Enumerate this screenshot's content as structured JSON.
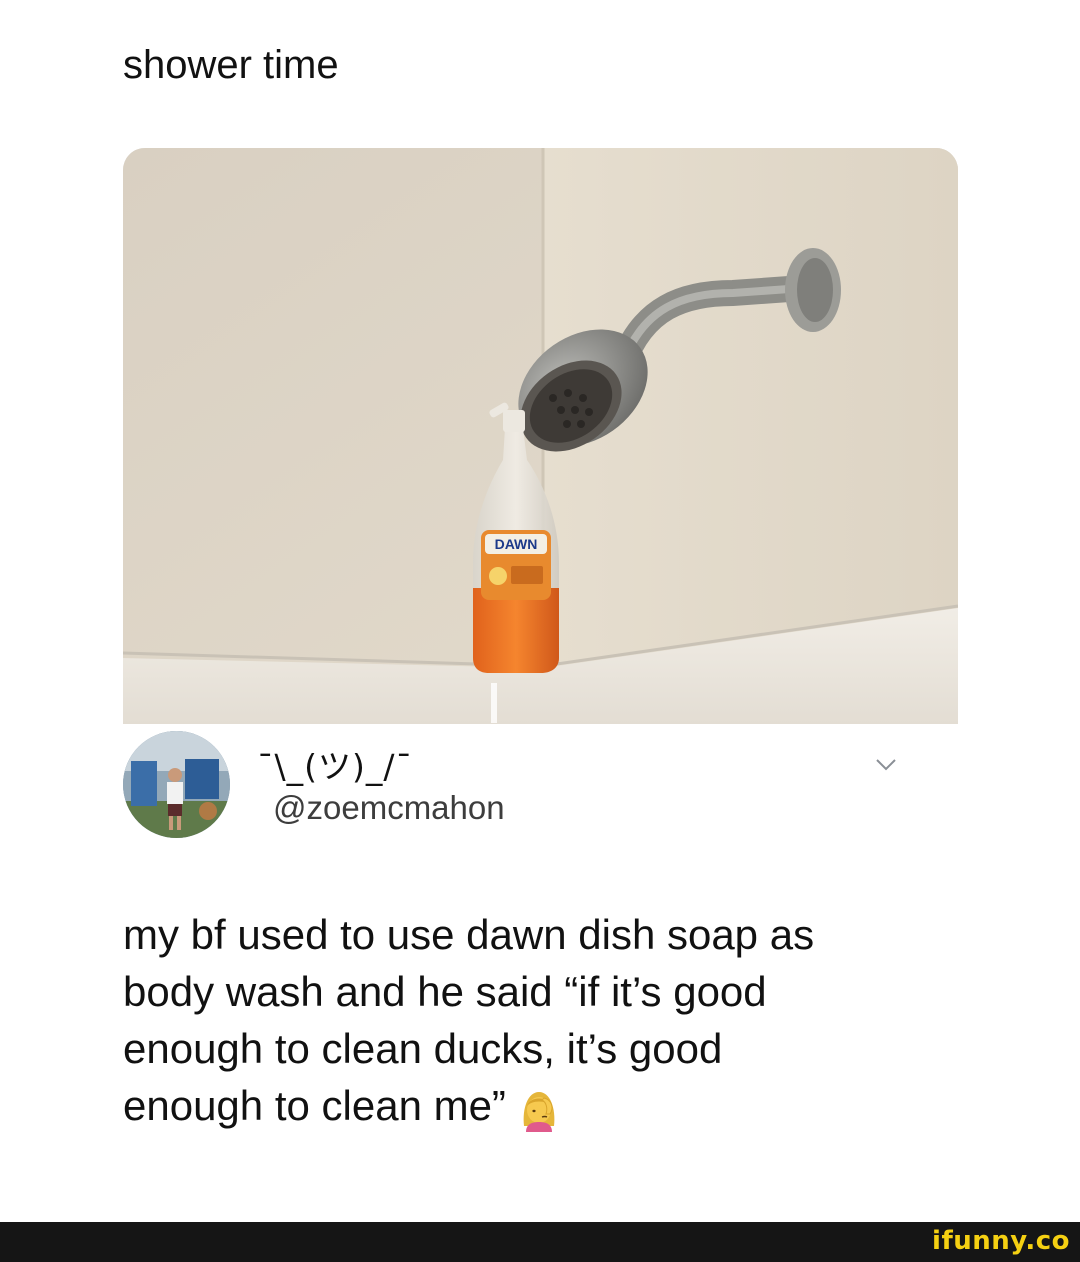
{
  "post": {
    "caption": "shower time"
  },
  "tweet": {
    "display_name": "¯\\_(ツ)_/¯",
    "handle": "@zoemcmahon",
    "body_lines": [
      "my bf used to use dawn dish soap as",
      "body wash and he said “if it’s good",
      "enough to clean ducks, it’s good",
      "enough to clean me”"
    ],
    "emoji": "face-palm-woman"
  },
  "photo": {
    "bottle_label": "DAWN"
  },
  "footer": {
    "watermark": "ifunny.co"
  },
  "colors": {
    "watermark": "#f5d012",
    "footer_bg": "#151515"
  }
}
